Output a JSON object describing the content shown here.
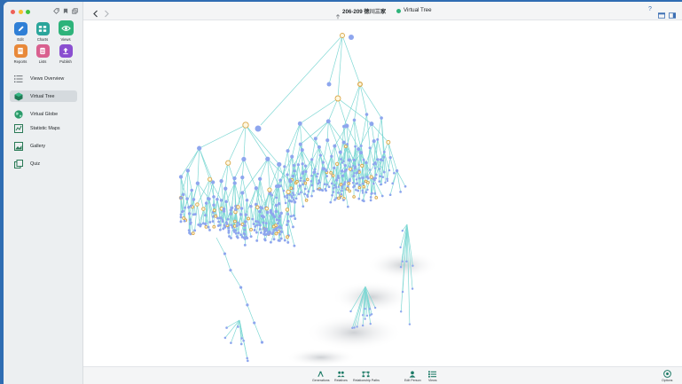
{
  "window": {
    "title_prefix_icon": "person-tree-icon",
    "title": "206-209 徳川三家",
    "view_name": "Virtual Tree"
  },
  "toolbar": {
    "edit": "Edit",
    "charts": "Charts",
    "views": "Views",
    "reports": "Reports",
    "lists": "Lists",
    "publish": "Publish"
  },
  "sidebar": {
    "items": [
      {
        "label": "Views Overview",
        "icon": "list-icon"
      },
      {
        "label": "Virtual Tree",
        "icon": "cube-icon",
        "active": true
      },
      {
        "label": "Virtual Globe",
        "icon": "globe-icon"
      },
      {
        "label": "Statistic Maps",
        "icon": "map-icon"
      },
      {
        "label": "Gallery",
        "icon": "gallery-icon"
      },
      {
        "label": "Quiz",
        "icon": "quiz-icon"
      }
    ]
  },
  "bottombar": {
    "generations": "Generations",
    "relatives": "Relatives",
    "relationship_paths": "Relationship Paths",
    "edit_person": "Edit Person",
    "views": "Views",
    "options": "Options"
  },
  "colors": {
    "accent_green": "#2db37a",
    "edit_blue": "#2f7fd6",
    "charts_teal": "#2aa59b",
    "reports_orange": "#e8893a",
    "lists_pink": "#d9608f",
    "publish_purple": "#8a4fd0",
    "tree_line": "#7fd8d4",
    "node_blue": "#8ea6ee",
    "node_gold": "#d9a84a"
  }
}
